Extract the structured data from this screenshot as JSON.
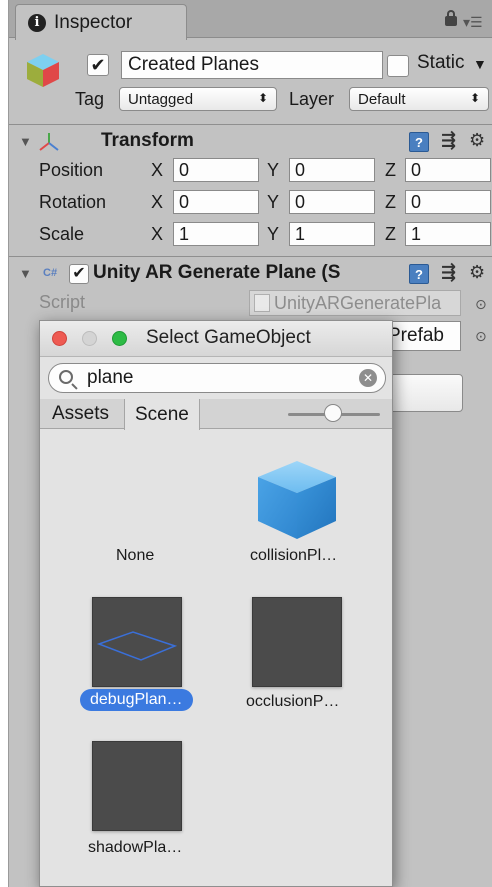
{
  "inspector_tab": {
    "title": "Inspector"
  },
  "header": {
    "object_name": "Created Planes",
    "active_checked": "✔",
    "static_label": "Static",
    "tag_label": "Tag",
    "tag_value": "Untagged",
    "layer_label": "Layer",
    "layer_value": "Default"
  },
  "transform": {
    "title": "Transform",
    "rows": [
      {
        "label": "Position",
        "x": "0",
        "y": "0",
        "z": "0"
      },
      {
        "label": "Rotation",
        "x": "0",
        "y": "0",
        "z": "0"
      },
      {
        "label": "Scale",
        "x": "1",
        "y": "1",
        "z": "1"
      }
    ],
    "axis_x": "X",
    "axis_y": "Y",
    "axis_z": "Z"
  },
  "ar_component": {
    "title": "Unity AR Generate Plane (S",
    "script_label": "Script",
    "script_value": "UnityARGeneratePla",
    "prefab_value": "Prefab",
    "cs_badge": "C#",
    "enabled_check": "✔"
  },
  "picker": {
    "title": "Select GameObject",
    "search_value": "plane",
    "tabs": [
      "Assets",
      "Scene"
    ],
    "active_tab": "Scene",
    "slider_level": 0.4,
    "items": [
      {
        "label": "None",
        "selected": false
      },
      {
        "label": "collisionPl…",
        "selected": false
      },
      {
        "label": "debugPlan…",
        "selected": true
      },
      {
        "label": "occlusionP…",
        "selected": false
      },
      {
        "label": "shadowPla…",
        "selected": false
      }
    ]
  },
  "colors": {
    "selection": "#3b7ae0",
    "cube_blue": "#4aa3e6",
    "close_light": "#ee5a52",
    "max_light": "#2dbb45"
  }
}
